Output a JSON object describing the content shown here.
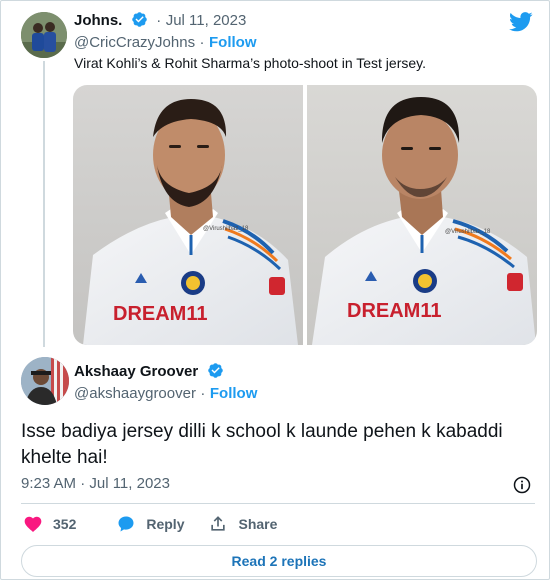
{
  "quoted_tweet": {
    "author_name": "Johns.",
    "handle": "@CricCrazyJohns",
    "date": "Jul 11, 2023",
    "dot": "·",
    "follow_label": "Follow",
    "text": "Virat Kohli’s & Rohit Sharma’s photo-shoot in Test jersey.",
    "photos": [
      {
        "name": "photo-virat-kohli",
        "watermark": "@Virushilbaz_18",
        "sponsor": "DREAM11"
      },
      {
        "name": "photo-rohit-sharma",
        "watermark": "@Virushilbaz_18",
        "sponsor": "DREAM11"
      }
    ]
  },
  "reply_tweet": {
    "author_name": "Akshaay Groover",
    "handle": "@akshaaygroover",
    "dot": "·",
    "follow_label": "Follow",
    "text": "Isse badiya jersey dilli k school k launde pehen k kabaddi khelte hai!",
    "timestamp": "9:23 AM · Jul 11, 2023",
    "likes": "352",
    "reply_label": "Reply",
    "share_label": "Share",
    "read_replies_label": "Read 2 replies"
  },
  "colors": {
    "accent": "#1d9bf0",
    "like": "#f91880",
    "muted": "#536471"
  }
}
